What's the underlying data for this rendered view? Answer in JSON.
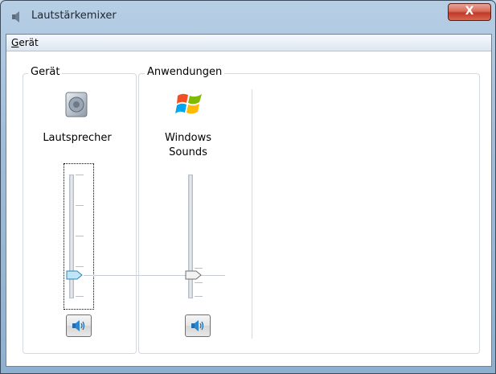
{
  "window": {
    "title": "Lautstärkemixer",
    "close_label": "X"
  },
  "menu": {
    "items": [
      {
        "label": "Gerät",
        "accel": "G",
        "rest": "erät"
      }
    ]
  },
  "device_group": {
    "label": "Gerät",
    "device": {
      "name": "Lautsprecher",
      "icon": "speaker-icon",
      "volume_level": 0.1,
      "muted": false
    }
  },
  "apps_group": {
    "label": "Anwendungen",
    "apps": [
      {
        "name_line1": "Windows",
        "name_line2": "Sounds",
        "icon": "windows-logo-icon",
        "volume_level": 0.1,
        "muted": false
      }
    ]
  }
}
